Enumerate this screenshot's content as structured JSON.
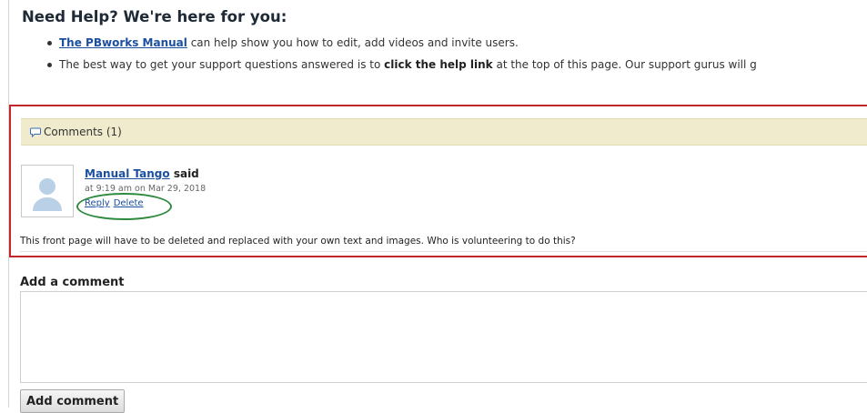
{
  "help": {
    "title": "Need Help? We're here for you:",
    "item1_link": "The PBworks Manual",
    "item1_text": " can help show you how to edit, add videos and invite users.",
    "item2_text_a": "The best way to get your support questions answered is to ",
    "item2_bold": "click the help link",
    "item2_text_b": " at the top of this page. Our support gurus will g"
  },
  "comments": {
    "header": "Comments (1)",
    "items": [
      {
        "author": "Manual Tango",
        "said": "said",
        "time": "at 9:19 am on Mar 29, 2018",
        "reply": "Reply",
        "delete": "Delete",
        "body": "This front page will have to be deleted and replaced with your own text and images. Who is volunteering to do this?"
      }
    ]
  },
  "add_comment": {
    "title": "Add a comment",
    "textarea_value": "",
    "button_label": "Add comment"
  },
  "colors": {
    "link": "#1b4fa0",
    "annotation_red": "#c1262b",
    "annotation_green": "#2e8a3e",
    "comments_header_bg": "#efebcc"
  }
}
